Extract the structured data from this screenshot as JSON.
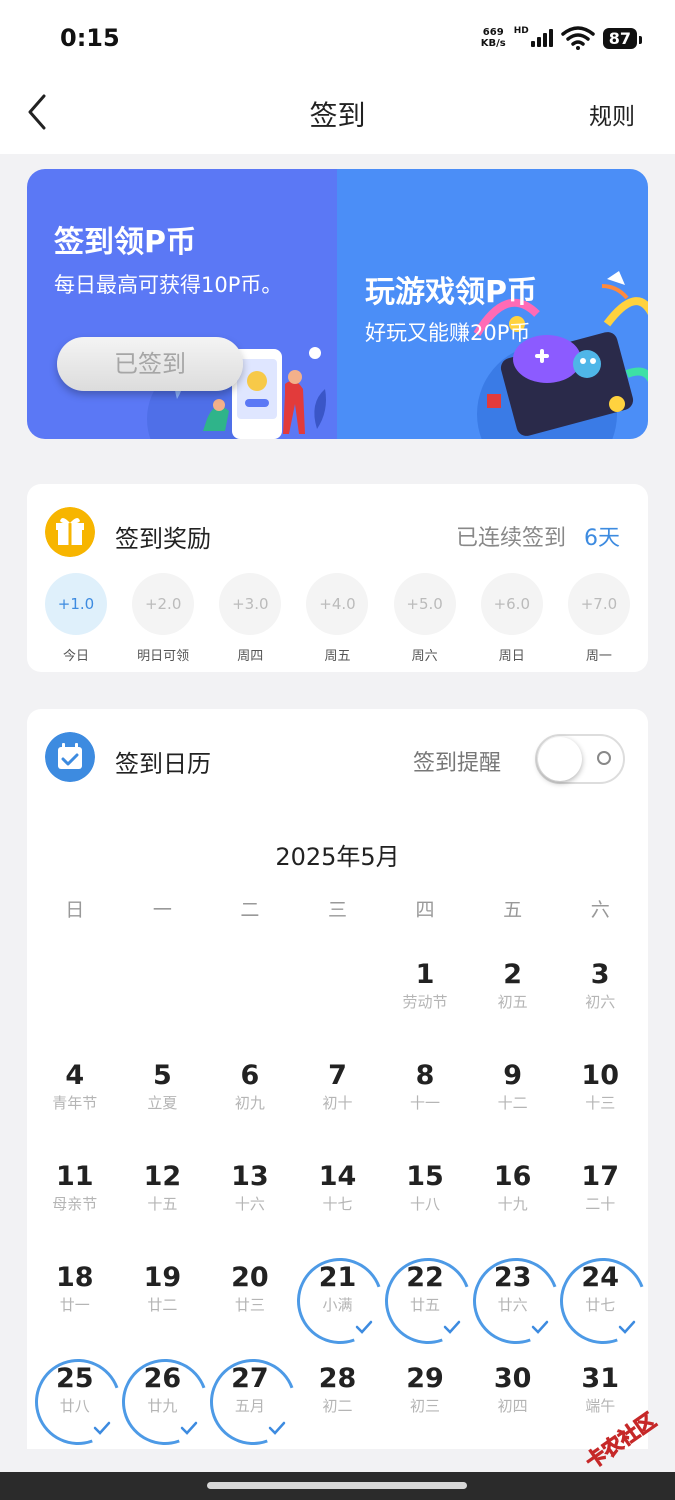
{
  "status": {
    "time": "0:15",
    "net_speed_top": "669",
    "net_speed_bottom": "KB/s",
    "hd": "HD",
    "battery": "87"
  },
  "nav": {
    "title": "签到",
    "rules": "规则"
  },
  "banner": {
    "left_title": "签到领P币",
    "left_sub": "每日最高可获得10P币。",
    "signed_button": "已签到",
    "right_title": "玩游戏领P币",
    "right_sub": "好玩又能赚20P币"
  },
  "reward": {
    "title": "签到奖励",
    "streak_label": "已连续签到",
    "streak_days": "6天",
    "items": [
      {
        "value": "+1.0",
        "label": "今日",
        "active": true
      },
      {
        "value": "+2.0",
        "label": "明日可领",
        "active": false
      },
      {
        "value": "+3.0",
        "label": "周四",
        "active": false
      },
      {
        "value": "+4.0",
        "label": "周五",
        "active": false
      },
      {
        "value": "+5.0",
        "label": "周六",
        "active": false
      },
      {
        "value": "+6.0",
        "label": "周日",
        "active": false
      },
      {
        "value": "+7.0",
        "label": "周一",
        "active": false
      }
    ]
  },
  "calendar": {
    "title": "签到日历",
    "remind_label": "签到提醒",
    "remind_on": false,
    "month": "2025年5月",
    "weekdays": [
      "日",
      "一",
      "二",
      "三",
      "四",
      "五",
      "六"
    ],
    "leading_blanks": 4,
    "days": [
      {
        "num": "1",
        "sub": "劳动节",
        "checked": false
      },
      {
        "num": "2",
        "sub": "初五",
        "checked": false
      },
      {
        "num": "3",
        "sub": "初六",
        "checked": false
      },
      {
        "num": "4",
        "sub": "青年节",
        "checked": false
      },
      {
        "num": "5",
        "sub": "立夏",
        "checked": false
      },
      {
        "num": "6",
        "sub": "初九",
        "checked": false
      },
      {
        "num": "7",
        "sub": "初十",
        "checked": false
      },
      {
        "num": "8",
        "sub": "十一",
        "checked": false
      },
      {
        "num": "9",
        "sub": "十二",
        "checked": false
      },
      {
        "num": "10",
        "sub": "十三",
        "checked": false
      },
      {
        "num": "11",
        "sub": "母亲节",
        "checked": false
      },
      {
        "num": "12",
        "sub": "十五",
        "checked": false
      },
      {
        "num": "13",
        "sub": "十六",
        "checked": false
      },
      {
        "num": "14",
        "sub": "十七",
        "checked": false
      },
      {
        "num": "15",
        "sub": "十八",
        "checked": false
      },
      {
        "num": "16",
        "sub": "十九",
        "checked": false
      },
      {
        "num": "17",
        "sub": "二十",
        "checked": false
      },
      {
        "num": "18",
        "sub": "廿一",
        "checked": false
      },
      {
        "num": "19",
        "sub": "廿二",
        "checked": false
      },
      {
        "num": "20",
        "sub": "廿三",
        "checked": false
      },
      {
        "num": "21",
        "sub": "小满",
        "checked": true
      },
      {
        "num": "22",
        "sub": "廿五",
        "checked": true
      },
      {
        "num": "23",
        "sub": "廿六",
        "checked": true
      },
      {
        "num": "24",
        "sub": "廿七",
        "checked": true
      },
      {
        "num": "25",
        "sub": "廿八",
        "checked": true
      },
      {
        "num": "26",
        "sub": "廿九",
        "checked": true
      },
      {
        "num": "27",
        "sub": "五月",
        "checked": true
      },
      {
        "num": "28",
        "sub": "初二",
        "checked": false
      },
      {
        "num": "29",
        "sub": "初三",
        "checked": false
      },
      {
        "num": "30",
        "sub": "初四",
        "checked": false
      },
      {
        "num": "31",
        "sub": "端午",
        "checked": false
      }
    ]
  },
  "colors": {
    "accent": "#3d8be0",
    "banner_left": "#5b78f5",
    "banner_right": "#4b8ef7",
    "gift_icon_bg": "#f7b500",
    "calendar_icon_bg": "#3d8be0"
  },
  "watermark_text": "卡农社区"
}
